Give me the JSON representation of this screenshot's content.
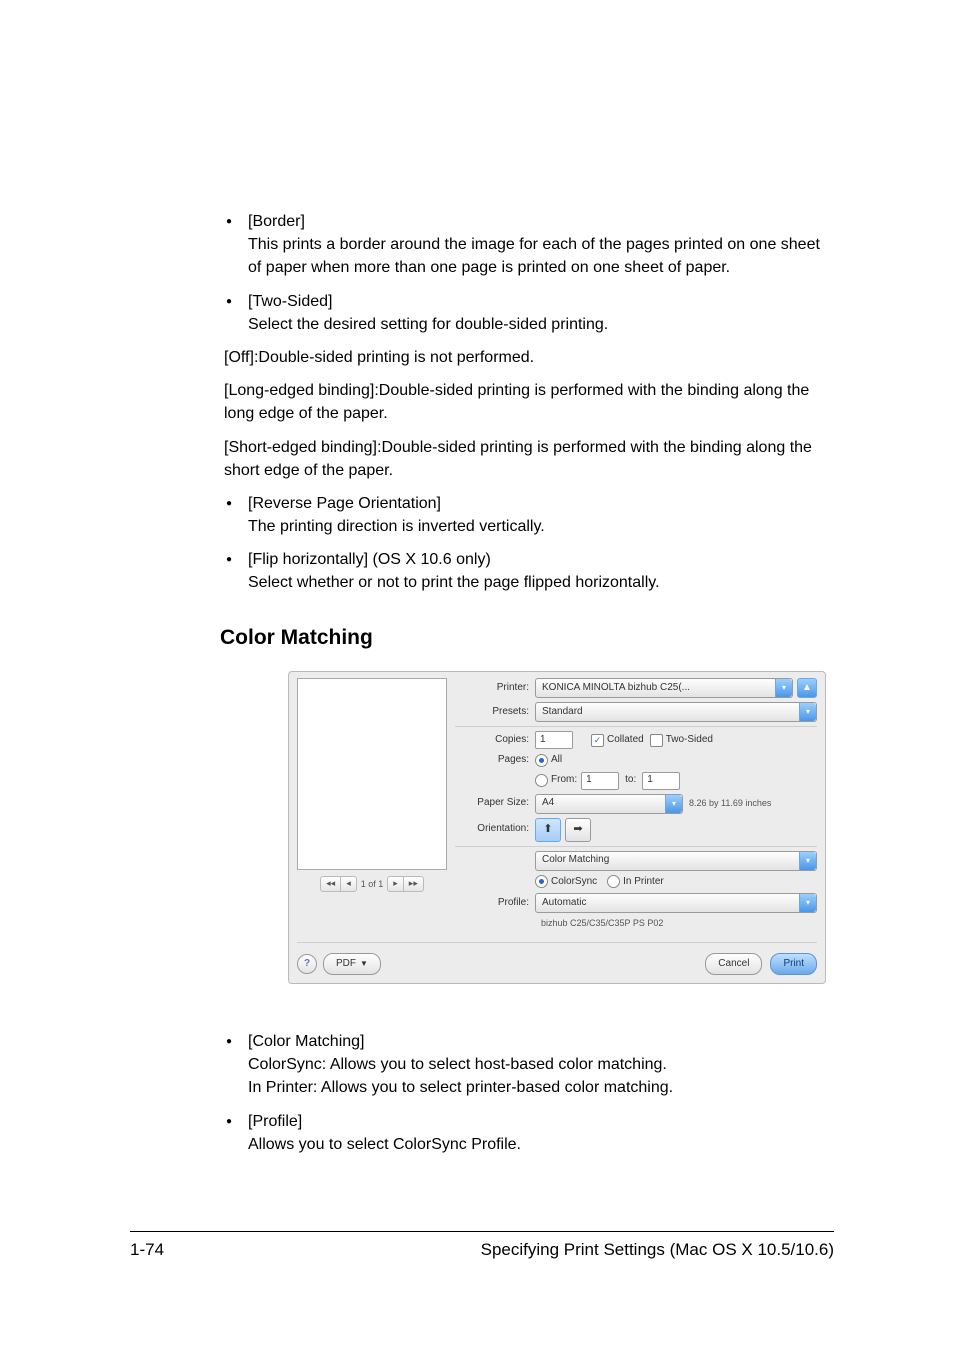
{
  "bullets_top": [
    {
      "title": "[Border]",
      "desc": "This prints a border around the image for each of the pages printed on one sheet of paper when more than one page is printed on one sheet of paper."
    },
    {
      "title": "[Two-Sided]",
      "desc": "Select the desired setting for double-sided printing."
    }
  ],
  "paras": [
    "[Off]:Double-sided printing is not performed.",
    "[Long-edged binding]:Double-sided printing is performed with the binding along the long edge of the paper.",
    "[Short-edged binding]:Double-sided printing is performed with the binding along the short edge of the paper."
  ],
  "bullets_mid": [
    {
      "title": "[Reverse Page Orientation]",
      "desc": "The printing direction is inverted vertically."
    },
    {
      "title": "[Flip horizontally] (OS X 10.6 only)",
      "desc": "Select whether or not to print the page flipped horizontally."
    }
  ],
  "section_heading": "Color Matching",
  "bullets_bottom": [
    {
      "title": "[Color Matching]",
      "desc": "ColorSync: Allows you to select host-based color matching.",
      "desc2": "In Printer: Allows you to select printer-based color matching."
    },
    {
      "title": "[Profile]",
      "desc": "Allows you to select ColorSync Profile."
    }
  ],
  "footer": {
    "page": "1-74",
    "title": "Specifying Print Settings (Mac OS X 10.5/10.6)"
  },
  "dlg": {
    "labels": {
      "printer": "Printer:",
      "presets": "Presets:",
      "copies": "Copies:",
      "pages": "Pages:",
      "paper_size": "Paper Size:",
      "orientation": "Orientation:",
      "profile": "Profile:",
      "from": "From:",
      "to": "to:"
    },
    "printer": "KONICA MINOLTA bizhub C25(...",
    "presets": "Standard",
    "copies": "1",
    "collated_label": "Collated",
    "two_sided_label": "Two-Sided",
    "pages_all": "All",
    "from": "1",
    "to": "1",
    "paper_size": "A4",
    "paper_note": "8.26 by 11.69 inches",
    "section_select": "Color Matching",
    "cm_colorsync": "ColorSync",
    "cm_inprinter": "In Printer",
    "profile": "Automatic",
    "profile_note": "bizhub C25/C35/C35P PS P02",
    "nav": "1 of 1",
    "help": "?",
    "pdf": "PDF",
    "cancel": "Cancel",
    "print": "Print"
  }
}
